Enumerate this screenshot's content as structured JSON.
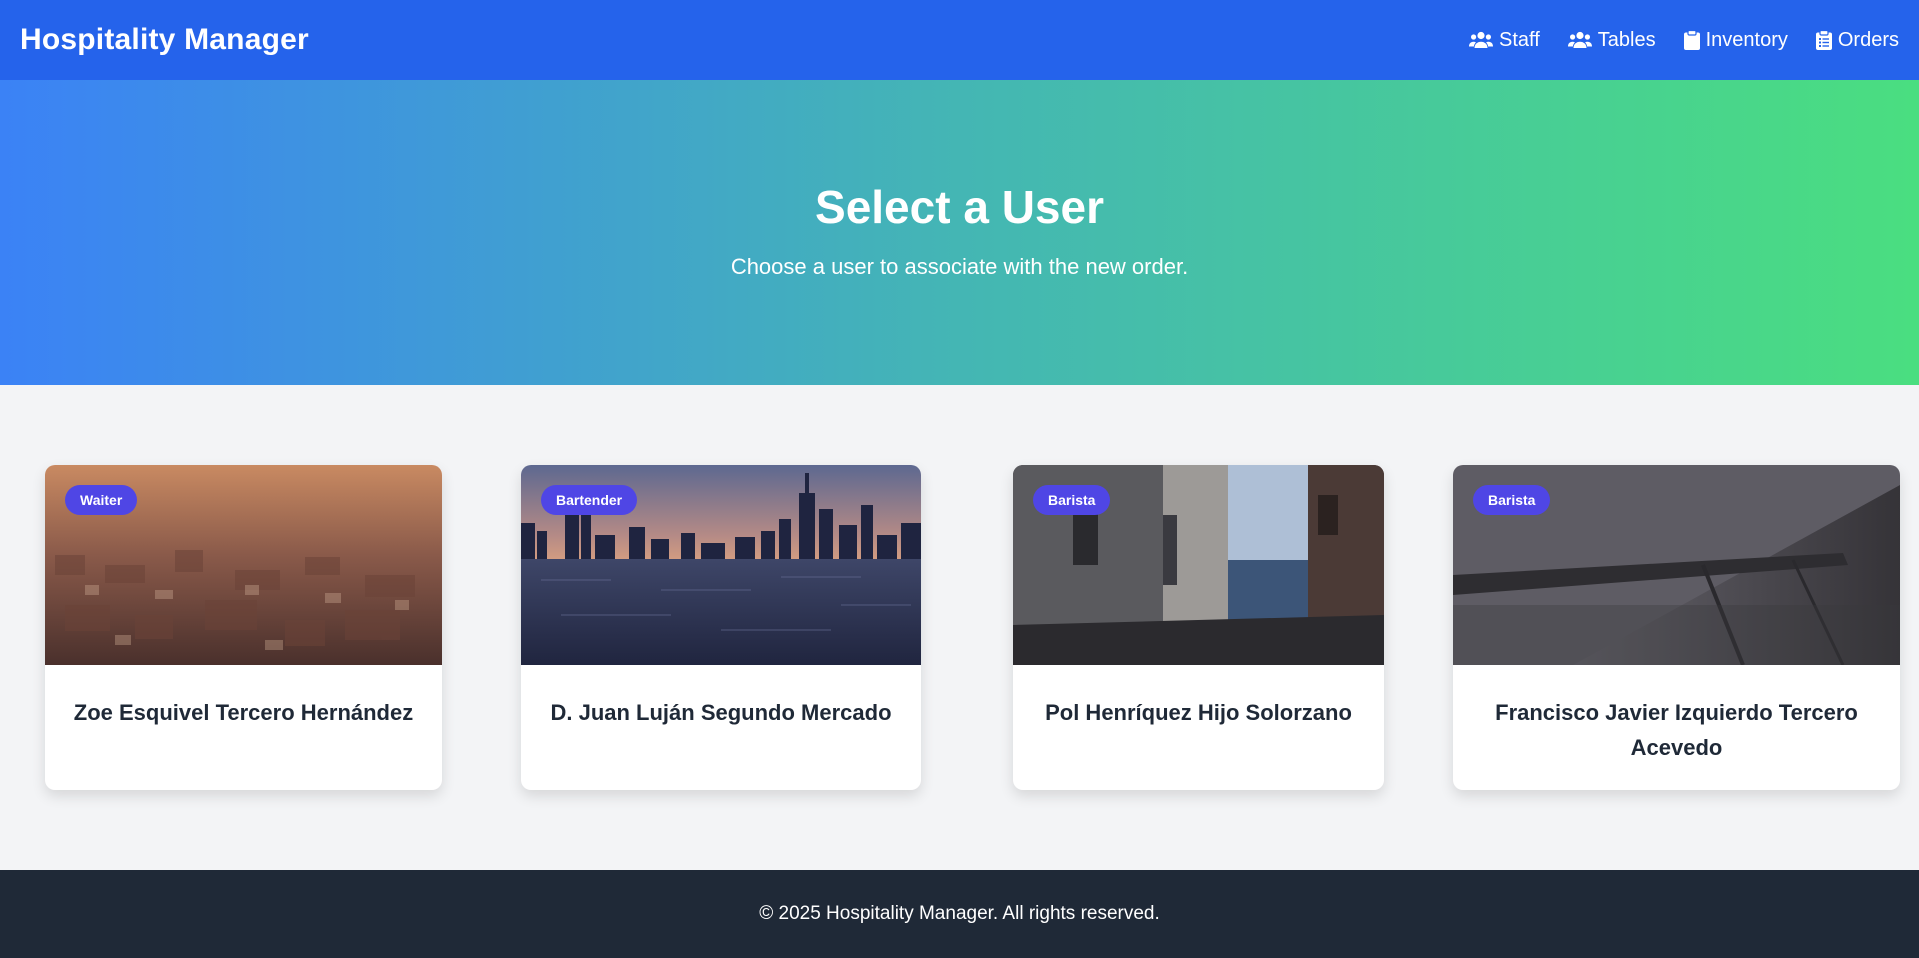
{
  "header": {
    "brand": "Hospitality Manager",
    "nav": [
      {
        "label": "Staff",
        "icon": "users-icon"
      },
      {
        "label": "Tables",
        "icon": "users-icon"
      },
      {
        "label": "Inventory",
        "icon": "clipboard-icon"
      },
      {
        "label": "Orders",
        "icon": "clipboard-list-icon"
      }
    ]
  },
  "hero": {
    "title": "Select a User",
    "subtitle": "Choose a user to associate with the new order."
  },
  "users": [
    {
      "name": "Zoe Esquivel Tercero Hernández",
      "role": "Waiter"
    },
    {
      "name": "D. Juan Luján Segundo Mercado",
      "role": "Bartender"
    },
    {
      "name": "Pol Henríquez Hijo Solorzano",
      "role": "Barista"
    },
    {
      "name": "Francisco Javier Izquierdo Tercero Acevedo",
      "role": "Barista"
    }
  ],
  "footer": {
    "text": "© 2025 Hospitality Manager. All rights reserved."
  },
  "colors": {
    "nav_bg": "#2563eb",
    "hero_gradient_start": "#3b82f6",
    "hero_gradient_end": "#4ade80",
    "badge": "#4f46e5",
    "footer_bg": "#1f2937"
  }
}
